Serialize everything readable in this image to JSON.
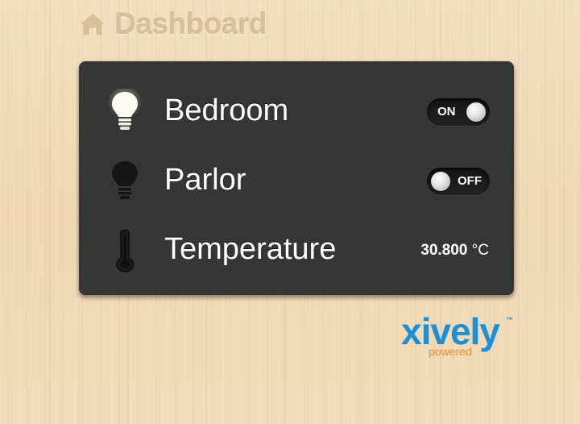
{
  "header": {
    "title": "Dashboard",
    "icon": "home-icon"
  },
  "devices": [
    {
      "label": "Bedroom",
      "icon": "lightbulb-on-icon",
      "state": "ON"
    },
    {
      "label": "Parlor",
      "icon": "lightbulb-off-icon",
      "state": "OFF"
    },
    {
      "label": "Temperature",
      "icon": "thermometer-icon",
      "value": "30.800",
      "unit": "°C"
    }
  ],
  "logo": {
    "word": "xively",
    "tm": "™",
    "sub": "powered"
  },
  "colors": {
    "panel": "#353535",
    "header_text": "#d8c09b",
    "logo_blue": "#1d8fd6",
    "logo_orange": "#f08a2e"
  }
}
